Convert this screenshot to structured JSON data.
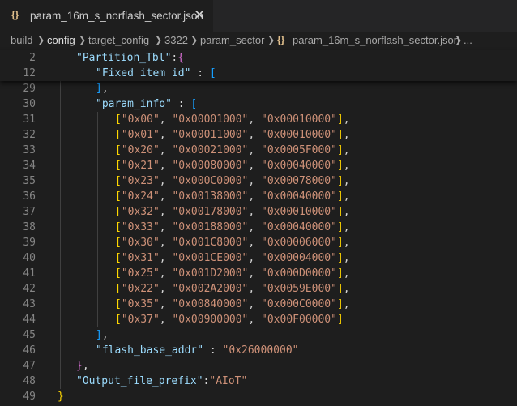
{
  "tab": {
    "icon": "{}",
    "label": "param_16m_s_norflash_sector.json",
    "close": "✕"
  },
  "breadcrumb": {
    "items": [
      "build",
      "config",
      "target_config",
      "3322",
      "param_sector"
    ],
    "file_icon": "{}",
    "file": "param_16m_s_norflash_sector.json",
    "ellipsis": "..."
  },
  "sticky_lines": [
    {
      "num": "2",
      "key": "\"Partition_Tbl\"",
      "rest": ":{"
    },
    {
      "num": "12",
      "key": "\"Fixed item id\"",
      "rest": " : ["
    }
  ],
  "lines": [
    {
      "num": "29"
    },
    {
      "num": "30"
    },
    {
      "num": "31"
    },
    {
      "num": "32"
    },
    {
      "num": "33"
    },
    {
      "num": "34"
    },
    {
      "num": "35"
    },
    {
      "num": "36"
    },
    {
      "num": "37"
    },
    {
      "num": "38"
    },
    {
      "num": "39"
    },
    {
      "num": "40"
    },
    {
      "num": "41"
    },
    {
      "num": "42"
    },
    {
      "num": "43"
    },
    {
      "num": "44"
    },
    {
      "num": "45"
    },
    {
      "num": "46"
    },
    {
      "num": "47"
    },
    {
      "num": "48"
    },
    {
      "num": "49"
    }
  ],
  "param_info_key": "\"param_info\"",
  "param_rows": [
    [
      "\"0x00\"",
      "\"0x00001000\"",
      "\"0x00010000\""
    ],
    [
      "\"0x01\"",
      "\"0x00011000\"",
      "\"0x00010000\""
    ],
    [
      "\"0x20\"",
      "\"0x00021000\"",
      "\"0x0005F000\""
    ],
    [
      "\"0x21\"",
      "\"0x00080000\"",
      "\"0x00040000\""
    ],
    [
      "\"0x23\"",
      "\"0x000C0000\"",
      "\"0x00078000\""
    ],
    [
      "\"0x24\"",
      "\"0x00138000\"",
      "\"0x00040000\""
    ],
    [
      "\"0x32\"",
      "\"0x00178000\"",
      "\"0x00010000\""
    ],
    [
      "\"0x33\"",
      "\"0x00188000\"",
      "\"0x00040000\""
    ],
    [
      "\"0x30\"",
      "\"0x001C8000\"",
      "\"0x00006000\""
    ],
    [
      "\"0x31\"",
      "\"0x001CE000\"",
      "\"0x00004000\""
    ],
    [
      "\"0x25\"",
      "\"0x001D2000\"",
      "\"0x000D0000\""
    ],
    [
      "\"0x22\"",
      "\"0x002A2000\"",
      "\"0x0059E000\""
    ],
    [
      "\"0x35\"",
      "\"0x00840000\"",
      "\"0x000C0000\""
    ],
    [
      "\"0x37\"",
      "\"0x00900000\"",
      "\"0x00F00000\""
    ]
  ],
  "flash_base_addr_key": "\"flash_base_addr\"",
  "flash_base_addr_value": "\"0x26000000\"",
  "output_prefix_key": "\"Output_file_prefix\"",
  "output_prefix_value": "\"AIoT\"",
  "colors": {
    "background": "#1e1e1e",
    "key": "#9cdcfe",
    "string": "#ce9178",
    "bracket_gold": "#ffd700",
    "bracket_orchid": "#da70d6",
    "bracket_blue": "#179fff",
    "line_number": "#858585"
  }
}
